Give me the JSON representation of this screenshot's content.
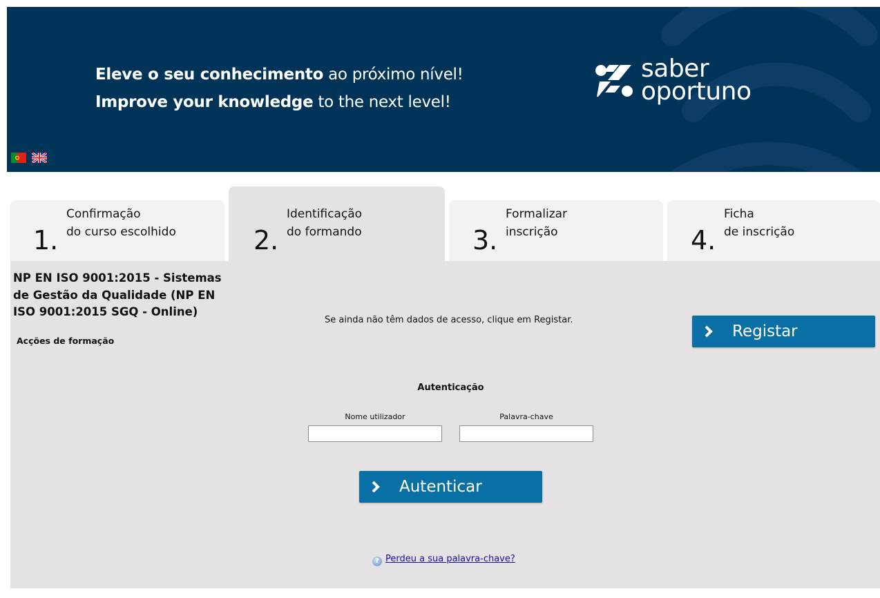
{
  "banner": {
    "tagline_pt_bold_1": "Eleve o seu ",
    "tagline_pt_bold_2": "conhecimento",
    "tagline_pt_light": " ao próximo nível!",
    "tagline_en_bold_1": "Improve your ",
    "tagline_en_bold_2": "knowledge",
    "tagline_en_light": " to the next level!",
    "logo_line_1": "saber",
    "logo_line_2": "oportuno",
    "background_color": "#003358",
    "languages": [
      {
        "name": "Português",
        "icon": "portugal-flag-icon"
      },
      {
        "name": "English",
        "icon": "uk-flag-icon"
      }
    ]
  },
  "tabs": [
    {
      "number": "1.",
      "line1": "Confirmação",
      "line2": "do curso escolhido",
      "active": false
    },
    {
      "number": "2.",
      "line1": "Identificação",
      "line2": "do formando",
      "active": true
    },
    {
      "number": "3.",
      "line1": "Formalizar",
      "line2": "inscrição",
      "active": false
    },
    {
      "number": "4.",
      "line1": "Ficha",
      "line2": "de inscrição",
      "active": false
    }
  ],
  "course": {
    "title": "NP EN ISO 9001:2015 - Sistemas de Gestão da Qualidade (NP EN ISO 9001:2015 SGQ - Online)",
    "subtitle": "Acções de formação"
  },
  "register": {
    "hint": "Se ainda não têm dados de acesso, clique em Registar.",
    "button_label": "Registar"
  },
  "auth": {
    "title": "Autenticação",
    "username_label": "Nome utilizador",
    "username_value": "",
    "password_label": "Palavra-chave",
    "password_value": "",
    "button_label": "Autenticar",
    "forgot_label": "Perdeu a sua palavra-chave?"
  },
  "colors": {
    "button": "#0a6fa5",
    "panel": "#e4e2e2",
    "tab_inactive": "#f2f2f2"
  }
}
